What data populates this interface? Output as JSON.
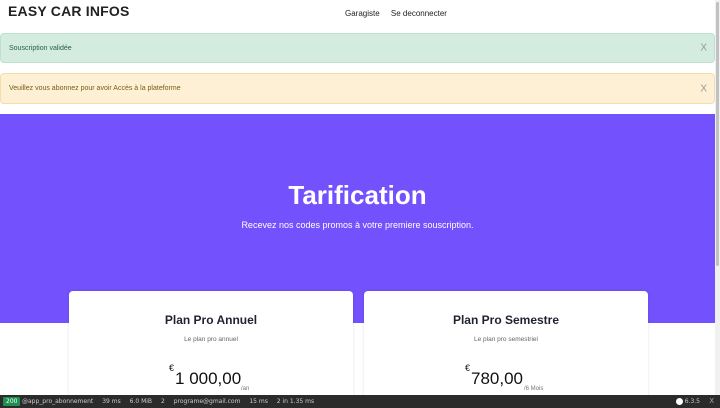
{
  "nav": {
    "brand": "EASY CAR INFOS",
    "links": [
      "Garagiste",
      "Se deconnecter"
    ]
  },
  "alerts": [
    {
      "text": "Souscription validée",
      "close": "X"
    },
    {
      "text": "Veuillez vous abonnez pour avoir Accès à la plateforme",
      "close": "X"
    }
  ],
  "hero": {
    "title": "Tarification",
    "subtitle": "Recevez nos codes promos à votre premiere souscription."
  },
  "plans": [
    {
      "title": "Plan Pro Annuel",
      "description": "Le plan pro annuel",
      "currency": "€",
      "price": "1 000,00",
      "period": "/an"
    },
    {
      "title": "Plan Pro Semestre",
      "description": "Le plan pro semestriel",
      "currency": "€",
      "price": "780,00",
      "period": "/6 Mois"
    }
  ],
  "debug_toolbar": {
    "status": "200",
    "route": "@app_pro_abonnement",
    "time": "39 ms",
    "memory": "6.0 MiB",
    "forms": "2",
    "user": "programe@gmail.com",
    "security": "15 ms",
    "db": "2 in 1.35 ms",
    "version": "6.3.5",
    "close": "X"
  }
}
